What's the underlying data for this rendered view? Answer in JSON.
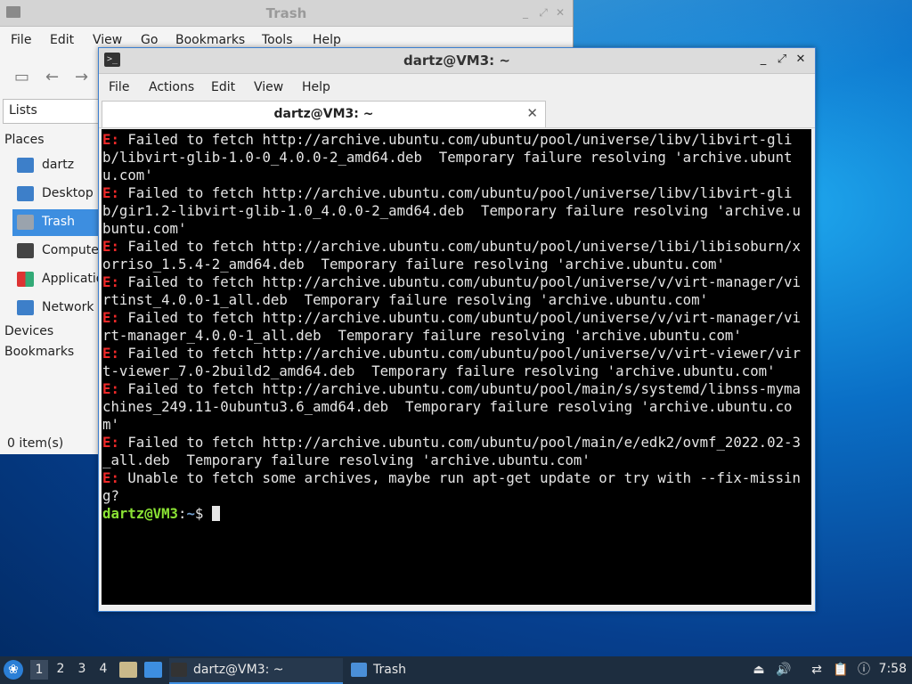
{
  "file_manager": {
    "title": "Trash",
    "menu": [
      "File",
      "Edit",
      "View",
      "Go",
      "Bookmarks",
      "Tools",
      "Help"
    ],
    "side_panel_mode": "Lists",
    "places_label": "Places",
    "places": [
      {
        "label": "dartz",
        "icon": "home-folder-icon",
        "color": "#3d7fc9"
      },
      {
        "label": "Desktop",
        "icon": "desktop-icon",
        "color": "#3d7fc9"
      },
      {
        "label": "Trash",
        "icon": "trash-icon",
        "color": "#9aa3ad"
      },
      {
        "label": "Computer",
        "icon": "computer-icon",
        "color": "#444444"
      },
      {
        "label": "Applications",
        "icon": "applications-icon",
        "color": "#d33"
      },
      {
        "label": "Network",
        "icon": "network-icon",
        "color": "#3d7fc9"
      }
    ],
    "active_place": "Trash",
    "devices_label": "Devices",
    "bookmarks_label": "Bookmarks",
    "status": "0 item(s)"
  },
  "terminal": {
    "title": "dartz@VM3: ~",
    "menu": [
      "File",
      "Actions",
      "Edit",
      "View",
      "Help"
    ],
    "tab_label": "dartz@VM3: ~",
    "lines": [
      {
        "prefix": "E:",
        "text": " Failed to fetch http://archive.ubuntu.com/ubuntu/pool/universe/libv/libvirt-glib/libvirt-glib-1.0-0_4.0.0-2_amd64.deb  Temporary failure resolving 'archive.ubuntu.com'"
      },
      {
        "prefix": "E:",
        "text": " Failed to fetch http://archive.ubuntu.com/ubuntu/pool/universe/libv/libvirt-glib/gir1.2-libvirt-glib-1.0_4.0.0-2_amd64.deb  Temporary failure resolving 'archive.ubuntu.com'"
      },
      {
        "prefix": "E:",
        "text": " Failed to fetch http://archive.ubuntu.com/ubuntu/pool/universe/libi/libisoburn/xorriso_1.5.4-2_amd64.deb  Temporary failure resolving 'archive.ubuntu.com'"
      },
      {
        "prefix": "E:",
        "text": " Failed to fetch http://archive.ubuntu.com/ubuntu/pool/universe/v/virt-manager/virtinst_4.0.0-1_all.deb  Temporary failure resolving 'archive.ubuntu.com'"
      },
      {
        "prefix": "E:",
        "text": " Failed to fetch http://archive.ubuntu.com/ubuntu/pool/universe/v/virt-manager/virt-manager_4.0.0-1_all.deb  Temporary failure resolving 'archive.ubuntu.com'"
      },
      {
        "prefix": "E:",
        "text": " Failed to fetch http://archive.ubuntu.com/ubuntu/pool/universe/v/virt-viewer/virt-viewer_7.0-2build2_amd64.deb  Temporary failure resolving 'archive.ubuntu.com'"
      },
      {
        "prefix": "E:",
        "text": " Failed to fetch http://archive.ubuntu.com/ubuntu/pool/main/s/systemd/libnss-mymachines_249.11-0ubuntu3.6_amd64.deb  Temporary failure resolving 'archive.ubuntu.com'"
      },
      {
        "prefix": "E:",
        "text": " Failed to fetch http://archive.ubuntu.com/ubuntu/pool/main/e/edk2/ovmf_2022.02-3_all.deb  Temporary failure resolving 'archive.ubuntu.com'"
      },
      {
        "prefix": "E:",
        "text": " Unable to fetch some archives, maybe run apt-get update or try with --fix-missing?"
      }
    ],
    "prompt": {
      "user_host": "dartz@VM3",
      "sep": ":",
      "path": "~",
      "symbol": "$ "
    }
  },
  "taskbar": {
    "workspaces": [
      "1",
      "2",
      "3",
      "4"
    ],
    "active_workspace": "1",
    "tasks": [
      {
        "label": "dartz@VM3: ~",
        "icon": "terminal-icon",
        "active": true
      },
      {
        "label": "Trash",
        "icon": "folder-icon",
        "active": false
      }
    ],
    "clock": "7:58"
  }
}
